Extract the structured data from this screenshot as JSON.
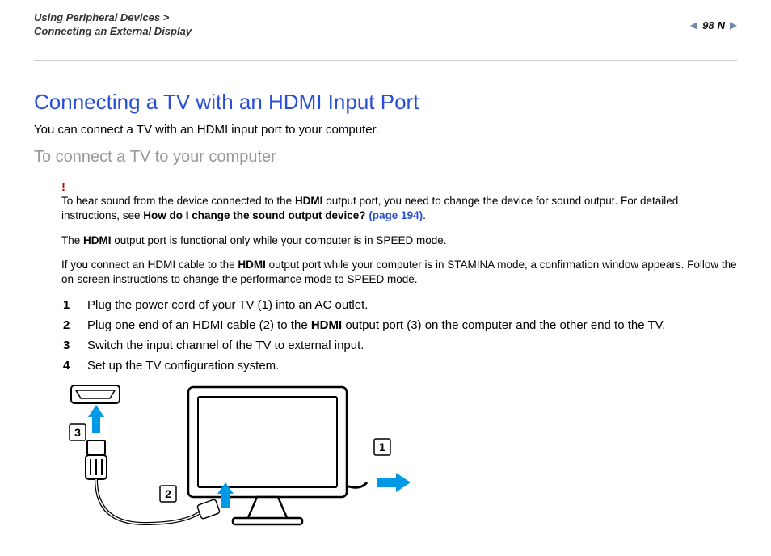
{
  "header": {
    "breadcrumb1": "Using Peripheral Devices >",
    "breadcrumb2": "Connecting an External Display",
    "page_number": "98",
    "n_label": "N"
  },
  "title": "Connecting a TV with an HDMI Input Port",
  "intro": "You can connect a TV with an HDMI input port to your computer.",
  "subheading": "To connect a TV to your computer",
  "note": {
    "bang": "!",
    "p1_a": "To hear sound from the device connected to the ",
    "p1_b": "HDMI",
    "p1_c": " output port, you need to change the device for sound output. For detailed instructions, see ",
    "p1_link_a": "How do I change the sound output device? ",
    "p1_link_b": "(page 194)",
    "p1_d": ".",
    "p2_a": "The ",
    "p2_b": "HDMI",
    "p2_c": " output port is functional only while your computer is in SPEED mode.",
    "p3_a": "If you connect an HDMI cable to the ",
    "p3_b": "HDMI",
    "p3_c": " output port while your computer is in STAMINA mode, a confirmation window appears. Follow the on-screen instructions to change the performance mode to SPEED mode."
  },
  "steps": [
    {
      "n": "1",
      "text_a": "Plug the power cord of your TV (1) into an AC outlet."
    },
    {
      "n": "2",
      "text_a": "Plug one end of an HDMI cable (2) to the ",
      "bold": "HDMI",
      "text_b": " output port (3) on the computer and the other end to the TV."
    },
    {
      "n": "3",
      "text_a": "Switch the input channel of the TV to external input."
    },
    {
      "n": "4",
      "text_a": "Set up the TV configuration system."
    }
  ],
  "diagram": {
    "label1": "1",
    "label2": "2",
    "label3": "3"
  }
}
